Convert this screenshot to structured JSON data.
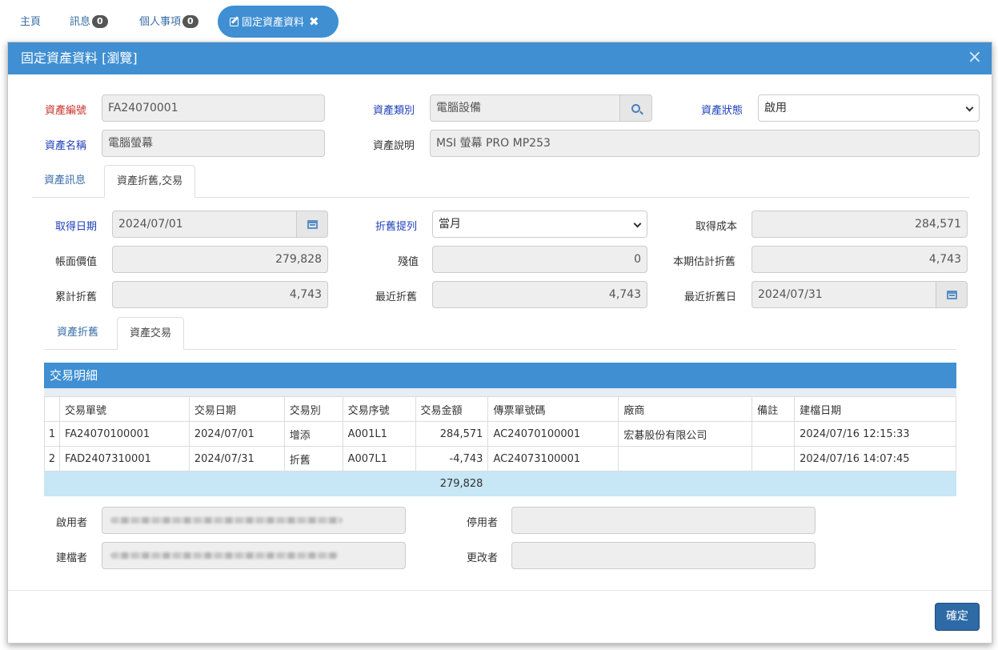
{
  "nav": {
    "tabs": [
      {
        "label": "主頁"
      },
      {
        "label": "訊息",
        "badge": "0"
      },
      {
        "label": "個人事項",
        "badge": "0"
      }
    ],
    "active_tab": "固定資產資料"
  },
  "modal": {
    "title": "固定資產資料 [瀏覽]",
    "close": "×",
    "asset_no_label": "資產編號",
    "asset_no": "FA24070001",
    "asset_type_label": "資產類別",
    "asset_type": "電腦設備",
    "asset_status_label": "資產狀態",
    "asset_status": "啟用",
    "asset_name_label": "資產名稱",
    "asset_name": "電腦螢幕",
    "asset_desc_label": "資產說明",
    "asset_desc": "MSI 螢幕 PRO MP253",
    "tabs": [
      "資產訊息",
      "資產折舊,交易"
    ],
    "acquire_date_label": "取得日期",
    "acquire_date": "2024/07/01",
    "depr_method_label": "折舊提列",
    "depr_method": "當月",
    "acquire_cost_label": "取得成本",
    "acquire_cost": "284,571",
    "book_value_label": "帳面價值",
    "book_value": "279,828",
    "residual_label": "殘值",
    "residual": "0",
    "est_depr_label": "本期估計折舊",
    "est_depr": "4,743",
    "accum_depr_label": "累計折舊",
    "accum_depr": "4,743",
    "recent_depr_label": "最近折舊",
    "recent_depr": "4,743",
    "recent_depr_date_label": "最近折舊日",
    "recent_depr_date": "2024/07/31",
    "subtabs": [
      "資產折舊",
      "資產交易"
    ],
    "panel_title": "交易明細",
    "columns": [
      "",
      "交易單號",
      "交易日期",
      "交易別",
      "交易序號",
      "交易金額",
      "傳票單號碼",
      "廠商",
      "備註",
      "建檔日期"
    ],
    "rows": [
      [
        "1",
        "FA24070100001",
        "2024/07/01",
        "增添",
        "A001L1",
        "284,571",
        "AC24070100001",
        "宏碁股份有限公司",
        "",
        "2024/07/16 12:15:33"
      ],
      [
        "2",
        "FAD2407310001",
        "2024/07/31",
        "折舊",
        "A007L1",
        "-4,743",
        "AC24073100001",
        "",
        "",
        "2024/07/16 14:07:45"
      ]
    ],
    "total": "279,828",
    "enabled_by_label": "啟用者",
    "disabled_by_label": "停用者",
    "created_by_label": "建檔者",
    "modified_by_label": "更改者",
    "ok_label": "確定"
  }
}
